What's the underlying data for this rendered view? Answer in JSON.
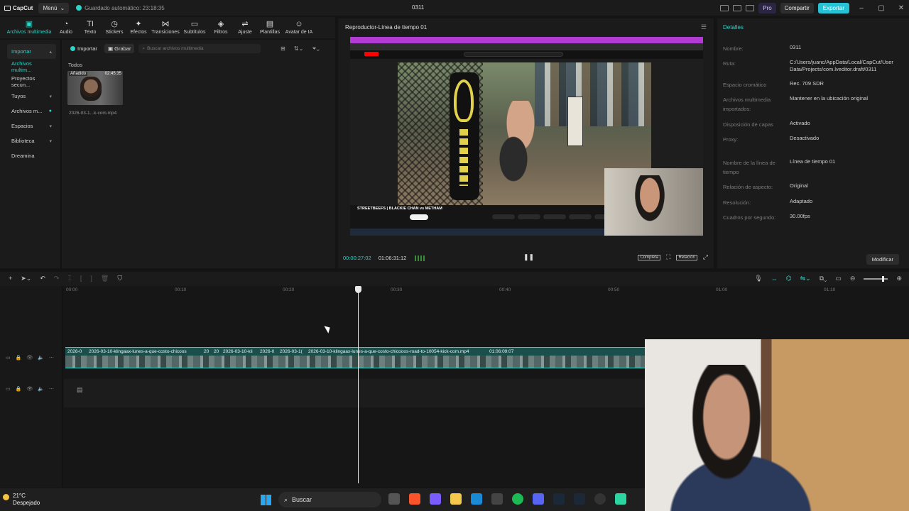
{
  "titlebar": {
    "app_name": "CapCut",
    "menu_label": "Menú",
    "autosave": "Guardado automático: 23:18:35",
    "project_title": "0311",
    "pro_label": "Pro",
    "share_label": "Compartir",
    "export_label": "Exportar"
  },
  "toolbar": {
    "items": [
      {
        "label": "Archivos multimedia",
        "icon": "media-icon"
      },
      {
        "label": "Audio",
        "icon": "audio-icon"
      },
      {
        "label": "Texto",
        "icon": "text-icon"
      },
      {
        "label": "Stickers",
        "icon": "sticker-icon"
      },
      {
        "label": "Efectos",
        "icon": "effects-icon"
      },
      {
        "label": "Transiciones",
        "icon": "transitions-icon"
      },
      {
        "label": "Subtítulos",
        "icon": "subtitles-icon"
      },
      {
        "label": "Filtros",
        "icon": "filters-icon"
      },
      {
        "label": "Ajuste",
        "icon": "adjust-icon"
      },
      {
        "label": "Plantillas",
        "icon": "templates-icon"
      },
      {
        "label": "Avatar de IA",
        "icon": "ai-avatar-icon"
      }
    ]
  },
  "left_nav": {
    "items": [
      "Importar",
      "Archivos multim...",
      "Proyectos secun...",
      "Tuyos",
      "Archivos m...",
      "Espacios",
      "Biblioteca",
      "Dreamina"
    ]
  },
  "media": {
    "import_label": "Importar",
    "record_label": "Grabar",
    "search_placeholder": "Buscar archivos multimedia",
    "section": "Todos",
    "thumb_tag": "Añadido",
    "thumb_duration": "02:45:35",
    "thumb_name": "2026-03-1...k-com.mp4"
  },
  "player": {
    "title": "Reproductor-Línea de tiempo 01",
    "yt_title": "STREETBEEFS | BLACKIE CHAN vs METHAM",
    "current_time": "00:00:27:02",
    "total_time": "01:06:31:12",
    "full_label": "Completa",
    "ratio_label": "Relación"
  },
  "details": {
    "title": "Detalles",
    "rows": [
      {
        "k": "Nombre:",
        "v": "0311"
      },
      {
        "k": "Ruta:",
        "v": "C:/Users/juanc/AppData/Local/CapCut/User Data/Projects/com.lveditor.draft/0311"
      },
      {
        "k": "Espacio cromático",
        "v": "Rec. 709 SDR"
      },
      {
        "k": "Archivos multimedia importados:",
        "v": "Mantener en la ubicación original"
      },
      {
        "k": "Disposición de capas",
        "v": "Activado"
      },
      {
        "k": "Proxy:",
        "v": "Desactivado"
      },
      {
        "k": "Nombre de la línea de tiempo",
        "v": "Línea de tiempo 01"
      },
      {
        "k": "Relación de aspecto:",
        "v": "Original"
      },
      {
        "k": "Resolución:",
        "v": "Adaptado"
      },
      {
        "k": "Cuadros por segundo:",
        "v": "30.00fps"
      }
    ],
    "modify_label": "Modificar"
  },
  "timeline": {
    "ticks": [
      "00:00",
      "00:10",
      "00:20",
      "00:30",
      "00:40",
      "00:50",
      "01:00",
      "01:10"
    ],
    "clip_labels": [
      "2026-0",
      "2026-03-10-klingaax-lunes-a-que-costo-chicoos",
      "20",
      "20",
      "2026-03-10-kli",
      "2026-0",
      "2026-03-1(",
      "2026-03-10-klingaax-lunes-a-que-costo-chicooos-road-to-10054-kick-com.mp4",
      "01:06:09:07"
    ]
  },
  "taskbar": {
    "temperature": "21°C",
    "weather": "Despejado",
    "search_label": "Buscar"
  }
}
